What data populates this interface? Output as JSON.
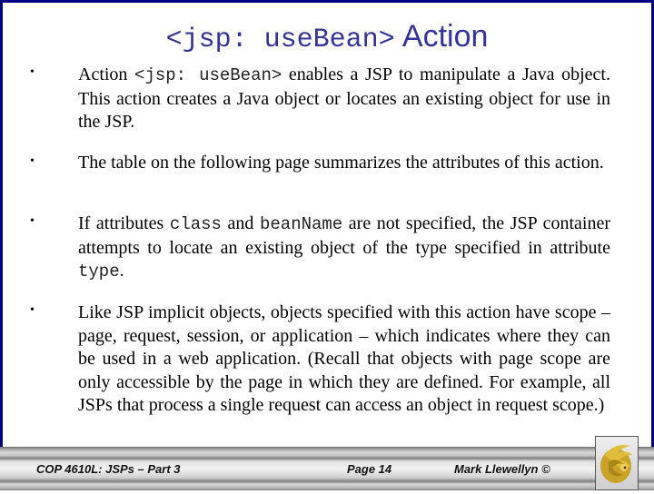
{
  "slide": {
    "title": {
      "code_part": "<jsp: useBean>",
      "text_part": "Action"
    },
    "bullets": [
      {
        "segments": [
          {
            "text": "Action ",
            "code": false
          },
          {
            "text": "<jsp: useBean>",
            "code": true
          },
          {
            "text": " enables a JSP to manipulate a Java object.  This action creates a Java object or locates an existing object for use in the JSP.",
            "code": false
          }
        ]
      },
      {
        "segments": [
          {
            "text": "The table on the following page summarizes the attributes of this action.",
            "code": false
          }
        ]
      },
      {
        "segments": [
          {
            "text": "If attributes ",
            "code": false
          },
          {
            "text": "class",
            "code": true
          },
          {
            "text": " and ",
            "code": false
          },
          {
            "text": "beanName",
            "code": true
          },
          {
            "text": " are not specified, the JSP container attempts to locate an existing object of the type specified in attribute ",
            "code": false
          },
          {
            "text": "type",
            "code": true
          },
          {
            "text": ".",
            "code": false
          }
        ]
      },
      {
        "segments": [
          {
            "text": "Like JSP implicit objects, objects specified with this action  have scope – page, request, session, or application – which indicates where they can be used in a web application.  (Recall that objects with page scope are only accessible by the page in which they are defined.  For example, all JSPs that process a single request can access an object in request scope.)",
            "code": false
          }
        ]
      }
    ],
    "bullet_glyph": "•"
  },
  "footer": {
    "course": "COP 4610L: JSPs – Part 3",
    "page": "Page 14",
    "author": "Mark Llewellyn ©",
    "logo_icon": "ucf-pegasus-logo-icon"
  },
  "colors": {
    "border": "#000080",
    "title": "#333399",
    "logo_gold": "#c9a227"
  }
}
